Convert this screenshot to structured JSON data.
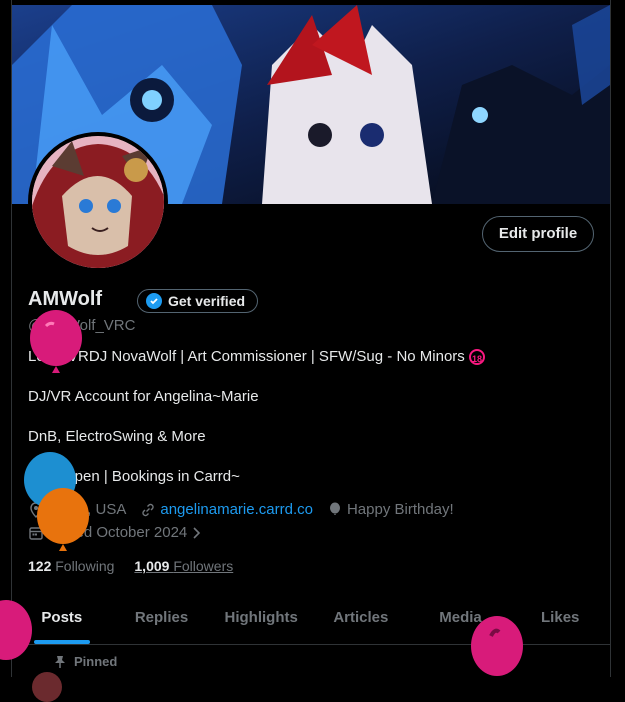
{
  "profile": {
    "name": "AMWolf",
    "handle": "@AMWolf_VRC",
    "edit_label": "Edit profile",
    "verify_label": "Get verified"
  },
  "bio": {
    "line1": "Local VRDJ NovaWolf | Art Commissioner | SFW/Sug - No Minors",
    "minor_badge": "18",
    "line2": "DJ/VR Account for Angelina~Marie",
    "line3": "DnB, ElectroSwing & More",
    "line4": "DMs Open | Bookings in Carrd~"
  },
  "meta": {
    "location": "Texas, USA",
    "website": "angelinamarie.carrd.co",
    "birthday": "Happy Birthday!",
    "joined": "Joined October 2024"
  },
  "stats": {
    "following_count": "122",
    "following_label": "Following",
    "followers_count": "1,009",
    "followers_label": "Followers"
  },
  "tabs": [
    {
      "label": "Posts"
    },
    {
      "label": "Replies"
    },
    {
      "label": "Highlights"
    },
    {
      "label": "Articles"
    },
    {
      "label": "Media"
    },
    {
      "label": "Likes"
    }
  ],
  "pinned_label": "Pinned",
  "colors": {
    "accent": "#1d9bf0",
    "balloon_pink": "#d81b7a",
    "balloon_blue": "#1d8fd1",
    "balloon_orange": "#e8730d"
  }
}
